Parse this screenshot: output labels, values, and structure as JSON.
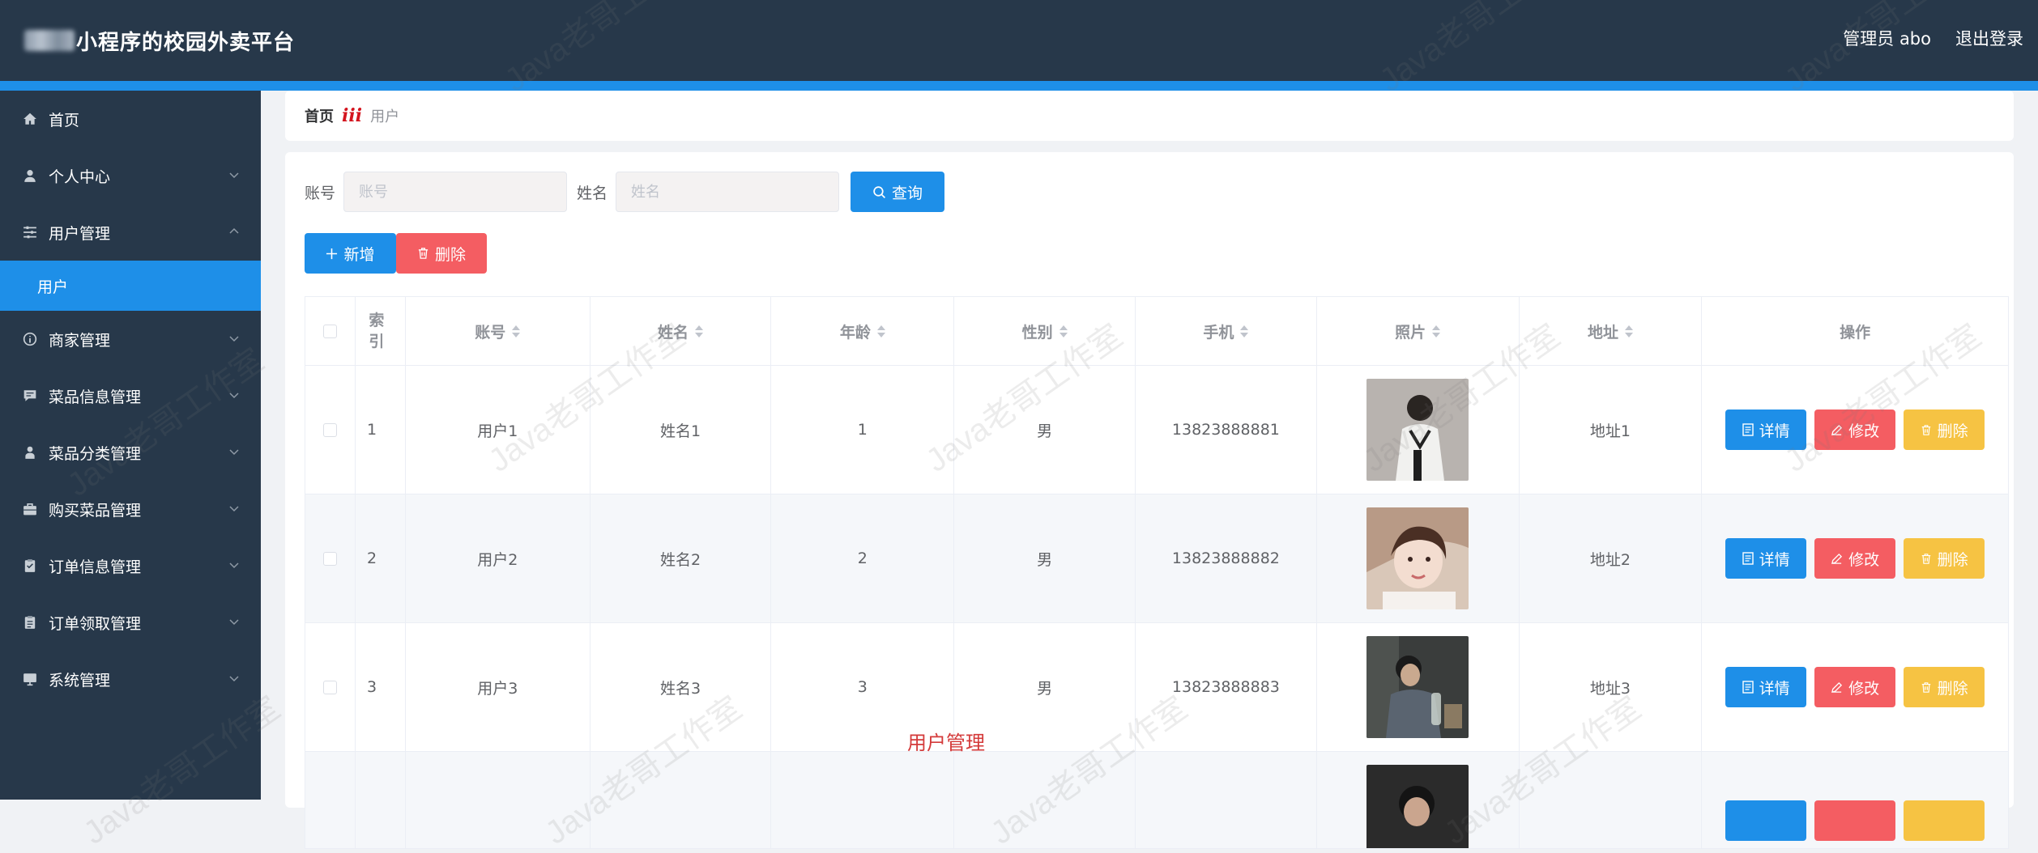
{
  "header": {
    "title": "小程序的校园外卖平台",
    "admin": "管理员 abo",
    "logout": "退出登录"
  },
  "sidebar": {
    "items": [
      {
        "label": "首页",
        "icon": "home-icon"
      },
      {
        "label": "个人中心",
        "icon": "user-icon"
      },
      {
        "label": "用户管理",
        "icon": "sliders-icon"
      },
      {
        "label": "商家管理",
        "icon": "info-icon"
      },
      {
        "label": "菜品信息管理",
        "icon": "chat-icon"
      },
      {
        "label": "菜品分类管理",
        "icon": "person-icon"
      },
      {
        "label": "购买菜品管理",
        "icon": "briefcase-icon"
      },
      {
        "label": "订单信息管理",
        "icon": "clipboard-icon"
      },
      {
        "label": "订单领取管理",
        "icon": "clipboard-list-icon"
      },
      {
        "label": "系统管理",
        "icon": "monitor-icon"
      }
    ],
    "sub_active": "用户"
  },
  "breadcrumb": {
    "home": "首页",
    "separator": "ⅲ",
    "current": "用户"
  },
  "search": {
    "account_label": "账号",
    "account_placeholder": "账号",
    "name_label": "姓名",
    "name_placeholder": "姓名",
    "query_button": "查询"
  },
  "actions": {
    "add": "新增",
    "delete": "删除"
  },
  "table": {
    "headers": {
      "index": "索引",
      "account": "账号",
      "name": "姓名",
      "age": "年龄",
      "gender": "性别",
      "phone": "手机",
      "photo": "照片",
      "address": "地址",
      "ops": "操作"
    },
    "rows": [
      {
        "index": "1",
        "account": "用户1",
        "name": "姓名1",
        "age": "1",
        "gender": "男",
        "phone": "13823888881",
        "address": "地址1"
      },
      {
        "index": "2",
        "account": "用户2",
        "name": "姓名2",
        "age": "2",
        "gender": "男",
        "phone": "13823888882",
        "address": "地址2"
      },
      {
        "index": "3",
        "account": "用户3",
        "name": "姓名3",
        "age": "3",
        "gender": "男",
        "phone": "13823888883",
        "address": "地址3"
      }
    ],
    "op_labels": {
      "detail": "详情",
      "edit": "修改",
      "delete": "删除"
    }
  },
  "watermark": "Java老哥工作室",
  "footer_title": "用户管理",
  "colors": {
    "header_bg": "#27384a",
    "accent": "#1e8fe8",
    "danger": "#f45d62",
    "warning": "#f6c343"
  }
}
